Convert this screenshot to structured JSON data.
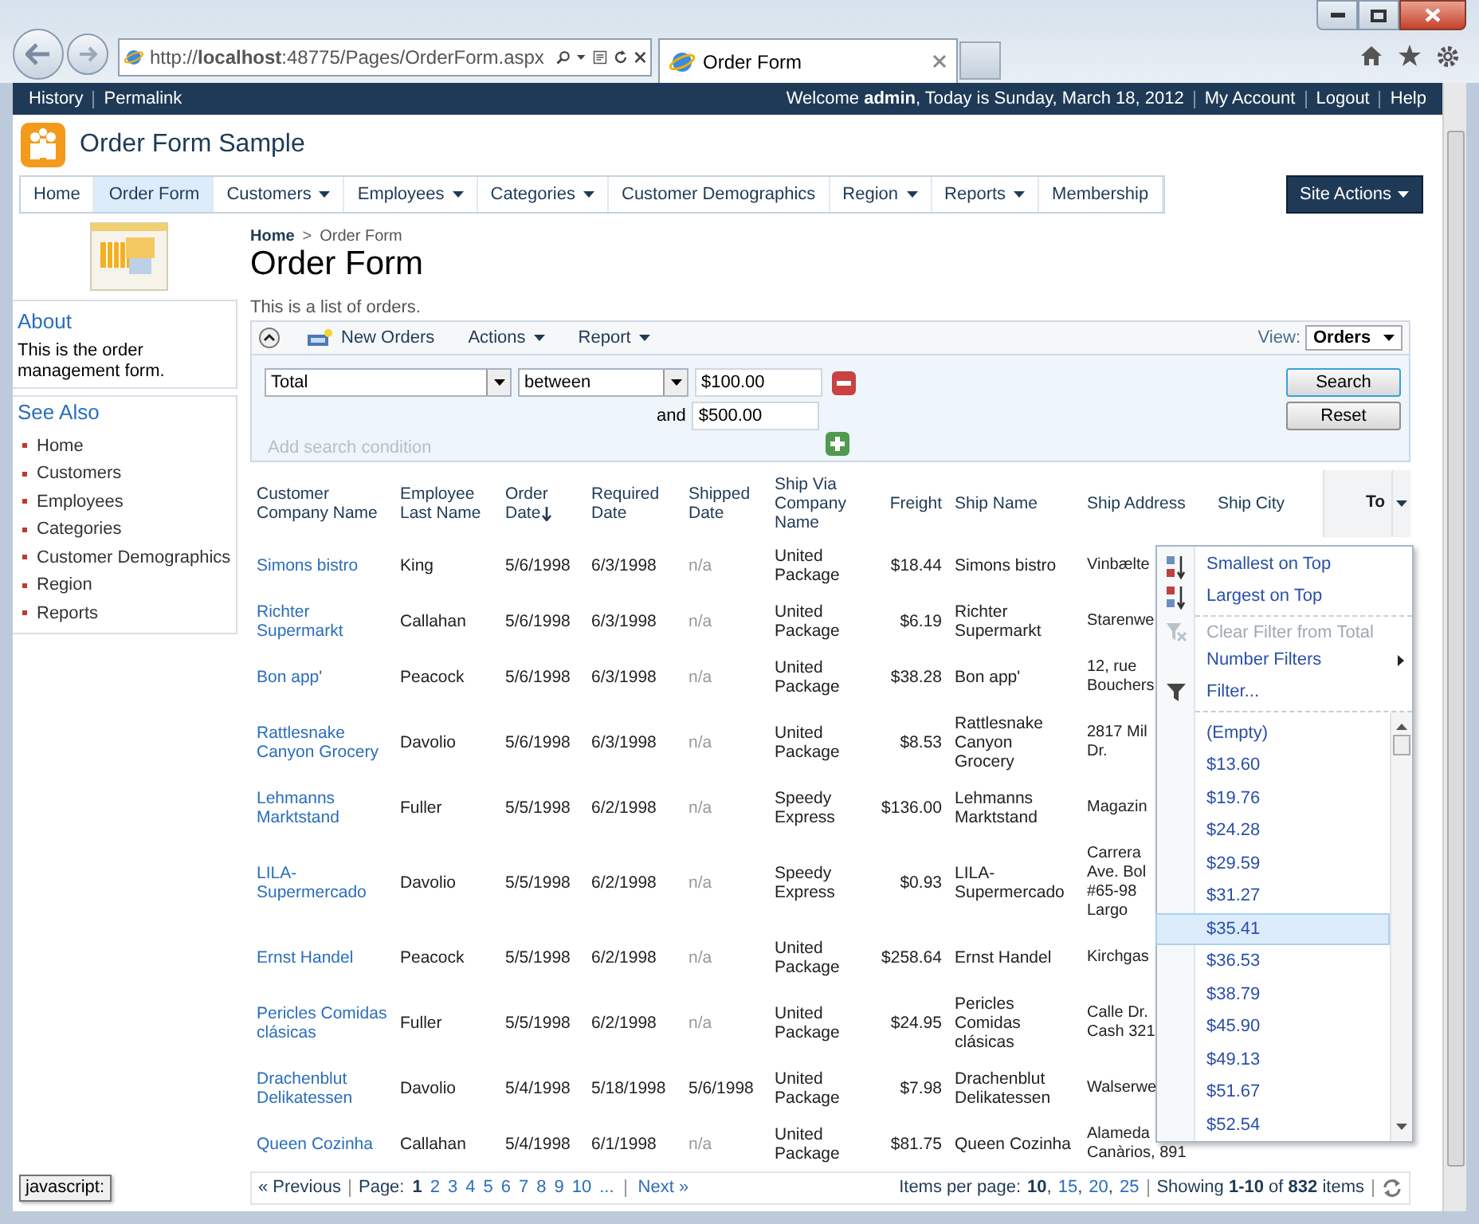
{
  "browser": {
    "address": "http://**localhost**:48775/Pages/OrderForm.aspx",
    "tab_title": "Order Form"
  },
  "top_bar": {
    "left_links": [
      "History",
      "Permalink"
    ],
    "welcome": "Welcome **admin**, Today is Sunday, March 18, 2012",
    "right_links": [
      "My Account",
      "Logout",
      "Help"
    ]
  },
  "app_title": "Order Form Sample",
  "nav": [
    {
      "label": "Home",
      "selected": false,
      "has_menu": false
    },
    {
      "label": "Order Form",
      "selected": true,
      "has_menu": false
    },
    {
      "label": "Customers",
      "selected": false,
      "has_menu": true
    },
    {
      "label": "Employees",
      "selected": false,
      "has_menu": true
    },
    {
      "label": "Categories",
      "selected": false,
      "has_menu": true
    },
    {
      "label": "Customer Demographics",
      "selected": false,
      "has_menu": false
    },
    {
      "label": "Region",
      "selected": false,
      "has_menu": true
    },
    {
      "label": "Reports",
      "selected": false,
      "has_menu": true
    },
    {
      "label": "Membership",
      "selected": false,
      "has_menu": false
    }
  ],
  "site_actions": "Site Actions",
  "sidebar": {
    "about_title": "About",
    "about_text": "This is the order management form.",
    "see_also_title": "See Also",
    "links": [
      "Home",
      "Customers",
      "Employees",
      "Categories",
      "Customer Demographics",
      "Region",
      "Reports"
    ]
  },
  "breadcrumb": {
    "items": [
      "Home",
      "Order Form"
    ],
    "separator": ">"
  },
  "page_title": "Order Form",
  "description": "This is a list of orders.",
  "toolbar": {
    "new_label": "New Orders",
    "menus": [
      "Actions",
      "Report"
    ],
    "view_label": "View:",
    "view_value": "Orders"
  },
  "filter": {
    "field": "Total",
    "operator": "between",
    "value_from": "$100.00",
    "conjunction": "and",
    "value_to": "$500.00",
    "add_condition": "Add search condition",
    "buttons": [
      "Search",
      "Reset"
    ]
  },
  "table": {
    "columns": [
      {
        "label": "Customer Company Name",
        "sorted": false,
        "filter_open": false
      },
      {
        "label": "Employee Last Name",
        "sorted": false,
        "filter_open": false
      },
      {
        "label": "Order Date",
        "sorted": true,
        "filter_open": false
      },
      {
        "label": "Required Date",
        "sorted": false,
        "filter_open": false
      },
      {
        "label": "Shipped Date",
        "sorted": false,
        "filter_open": false
      },
      {
        "label": "Ship Via Company Name",
        "sorted": false,
        "filter_open": false
      },
      {
        "label": "Freight",
        "sorted": false,
        "filter_open": false
      },
      {
        "label": "Ship Name",
        "sorted": false,
        "filter_open": false
      },
      {
        "label": "Ship Address",
        "sorted": false,
        "filter_open": false
      },
      {
        "label": "Ship City",
        "sorted": false,
        "filter_open": false
      },
      {
        "label": "To",
        "sorted": false,
        "filter_open": true
      }
    ],
    "rows": [
      {
        "customer": "Simons bistro",
        "employee": "King",
        "order_date": "5/6/1998",
        "required_date": "6/3/1998",
        "shipped_date": "n/a",
        "shipped": false,
        "ship_via": "United Package",
        "freight": "$18.44",
        "ship_name": "Simons bistro",
        "ship_address": [
          "Vinbælte"
        ]
      },
      {
        "customer": "Richter Supermarkt",
        "employee": "Callahan",
        "order_date": "5/6/1998",
        "required_date": "6/3/1998",
        "shipped_date": "n/a",
        "shipped": false,
        "ship_via": "United Package",
        "freight": "$6.19",
        "ship_name": "Richter Supermarkt",
        "ship_address": [
          "Starenwe"
        ]
      },
      {
        "customer": "Bon app'",
        "employee": "Peacock",
        "order_date": "5/6/1998",
        "required_date": "6/3/1998",
        "shipped_date": "n/a",
        "shipped": false,
        "ship_via": "United Package",
        "freight": "$38.28",
        "ship_name": "Bon app'",
        "ship_address": [
          "12, rue",
          "Bouchers"
        ]
      },
      {
        "customer": "Rattlesnake Canyon Grocery",
        "employee": "Davolio",
        "order_date": "5/6/1998",
        "required_date": "6/3/1998",
        "shipped_date": "n/a",
        "shipped": false,
        "ship_via": "United Package",
        "freight": "$8.53",
        "ship_name": "Rattlesnake Canyon Grocery",
        "ship_address": [
          "2817 Mil",
          "Dr."
        ]
      },
      {
        "customer": "Lehmanns Marktstand",
        "employee": "Fuller",
        "order_date": "5/5/1998",
        "required_date": "6/2/1998",
        "shipped_date": "n/a",
        "shipped": false,
        "ship_via": "Speedy Express",
        "freight": "$136.00",
        "ship_name": "Lehmanns Marktstand",
        "ship_address": [
          "Magazin"
        ]
      },
      {
        "customer": "LILA-Supermercado",
        "employee": "Davolio",
        "order_date": "5/5/1998",
        "required_date": "6/2/1998",
        "shipped_date": "n/a",
        "shipped": false,
        "ship_via": "Speedy Express",
        "freight": "$0.93",
        "ship_name": "LILA-Supermercado",
        "ship_address": [
          "Carrera",
          "Ave. Bol",
          "#65-98",
          "Largo"
        ]
      },
      {
        "customer": "Ernst Handel",
        "employee": "Peacock",
        "order_date": "5/5/1998",
        "required_date": "6/2/1998",
        "shipped_date": "n/a",
        "shipped": false,
        "ship_via": "United Package",
        "freight": "$258.64",
        "ship_name": "Ernst Handel",
        "ship_address": [
          "Kirchgas"
        ]
      },
      {
        "customer": "Pericles Comidas clásicas",
        "employee": "Fuller",
        "order_date": "5/5/1998",
        "required_date": "6/2/1998",
        "shipped_date": "n/a",
        "shipped": false,
        "ship_via": "United Package",
        "freight": "$24.95",
        "ship_name": "Pericles Comidas clásicas",
        "ship_address": [
          "Calle Dr.",
          "Cash 321"
        ]
      },
      {
        "customer": "Drachenblut Delikatessen",
        "employee": "Davolio",
        "order_date": "5/4/1998",
        "required_date": "5/18/1998",
        "shipped_date": "5/6/1998",
        "shipped": true,
        "ship_via": "United Package",
        "freight": "$7.98",
        "ship_name": "Drachenblut Delikatessen",
        "ship_address": [
          "Walserwe"
        ]
      },
      {
        "customer": "Queen Cozinha",
        "employee": "Callahan",
        "order_date": "5/4/1998",
        "required_date": "6/1/1998",
        "shipped_date": "n/a",
        "shipped": false,
        "ship_via": "United Package",
        "freight": "$81.75",
        "ship_name": "Queen Cozinha",
        "ship_address": [
          "Alameda",
          "Canàrios, 891"
        ]
      }
    ]
  },
  "filter_menu": {
    "items": [
      {
        "kind": "sort-asc",
        "label": "Smallest on Top",
        "disabled": false
      },
      {
        "kind": "sort-desc",
        "label": "Largest on Top",
        "disabled": false
      },
      {
        "kind": "clear-filter",
        "label": "Clear Filter from Total",
        "disabled": true
      },
      {
        "kind": "submenu",
        "label": "Number Filters",
        "disabled": false
      },
      {
        "kind": "filter",
        "label": "Filter...",
        "disabled": false
      }
    ],
    "values": [
      {
        "label": "(Empty)",
        "selected": false
      },
      {
        "label": "$13.60",
        "selected": false
      },
      {
        "label": "$19.76",
        "selected": false
      },
      {
        "label": "$24.28",
        "selected": false
      },
      {
        "label": "$29.59",
        "selected": false
      },
      {
        "label": "$31.27",
        "selected": false
      },
      {
        "label": "$35.41",
        "selected": true
      },
      {
        "label": "$36.53",
        "selected": false
      },
      {
        "label": "$38.79",
        "selected": false
      },
      {
        "label": "$45.90",
        "selected": false
      },
      {
        "label": "$49.13",
        "selected": false
      },
      {
        "label": "$51.67",
        "selected": false
      },
      {
        "label": "$52.54",
        "selected": false
      }
    ]
  },
  "pager": {
    "previous": "« Previous",
    "page_label": "Page:",
    "pages": [
      {
        "label": "1",
        "selected": true
      },
      {
        "label": "2",
        "selected": false
      },
      {
        "label": "3",
        "selected": false
      },
      {
        "label": "4",
        "selected": false
      },
      {
        "label": "5",
        "selected": false
      },
      {
        "label": "6",
        "selected": false
      },
      {
        "label": "7",
        "selected": false
      },
      {
        "label": "8",
        "selected": false
      },
      {
        "label": "9",
        "selected": false
      },
      {
        "label": "10",
        "selected": false
      }
    ],
    "ellipsis": "...",
    "next": "Next »",
    "per_page_label": "Items per page:",
    "per_page_separator": ",",
    "per_page": [
      {
        "label": "10",
        "selected": true
      },
      {
        "label": "15",
        "selected": false
      },
      {
        "label": "20",
        "selected": false
      },
      {
        "label": "25",
        "selected": false
      }
    ],
    "showing": "Showing **1-10** of **832** items"
  },
  "status_text": "javascript:"
}
